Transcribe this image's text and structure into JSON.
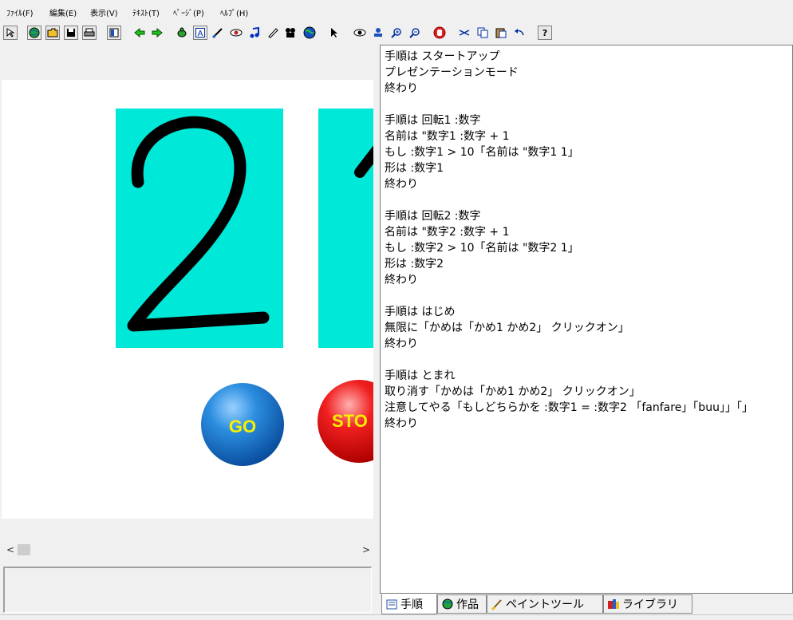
{
  "menu": {
    "file": "ﾌｧｲﾙ(F)",
    "edit": "編集(E)",
    "view": "表示(V)",
    "text": "ﾃｷｽﾄ(T)",
    "page": "ﾍﾟｰｼﾞ(P)",
    "help": "ﾍﾙﾌﾟ(H)"
  },
  "toolbar": {
    "icons": [
      "pointer-icon",
      "globe-icon",
      "open-folder-icon",
      "save-icon",
      "print-icon",
      "page-list-icon",
      "back-arrow-icon",
      "forward-arrow-icon",
      "turtle-icon",
      "text-box-icon",
      "paint-brush-icon",
      "eye-icon",
      "music-note-icon",
      "pen-icon",
      "movie-camera-icon",
      "world-icon",
      "select-arrow-icon",
      "watch-icon",
      "stamp-icon",
      "zoom-in-icon",
      "zoom-out-icon",
      "stop-hand-icon",
      "scissors-icon",
      "copy-icon",
      "paste-icon",
      "undo-icon",
      "help-icon"
    ],
    "help_label": "?"
  },
  "stage": {
    "card1_digit": "2",
    "go_label": "GO",
    "stop_label": "STO",
    "colors": {
      "card": "#00e8d8",
      "go": "#1a78d0",
      "stop": "#d81010",
      "label": "#f8f000"
    }
  },
  "editor": {
    "lines": [
      "手順は スタートアップ",
      "プレゼンテーションモード",
      "終わり",
      "",
      "手順は 回転1 :数字",
      "名前は \"数字1 :数字 + 1",
      "もし :数字1 > 10「名前は \"数字1 1」",
      "形は :数字1",
      "終わり",
      "",
      "手順は 回転2 :数字",
      "名前は \"数字2 :数字 + 1",
      "もし :数字2 > 10「名前は \"数字2 1」",
      "形は :数字2",
      "終わり",
      "",
      "手順は はじめ",
      "無限に「かめは「かめ1 かめ2」 クリックオン」",
      "終わり",
      "",
      "手順は とまれ",
      "取り消す「かめは「かめ1 かめ2」 クリックオン」",
      "注意してやる「もしどちらかを :数字1 = :数字2 「fanfare」「buu」」「」",
      "終わり"
    ]
  },
  "tabs": [
    {
      "label": "手順",
      "icon": "script-icon"
    },
    {
      "label": "作品",
      "icon": "globe-icon"
    },
    {
      "label": "ペイントツール",
      "icon": "paint-brush-icon"
    },
    {
      "label": "ライブラリ",
      "icon": "library-icon"
    }
  ],
  "scroll": {
    "left": "<",
    "right": ">"
  }
}
